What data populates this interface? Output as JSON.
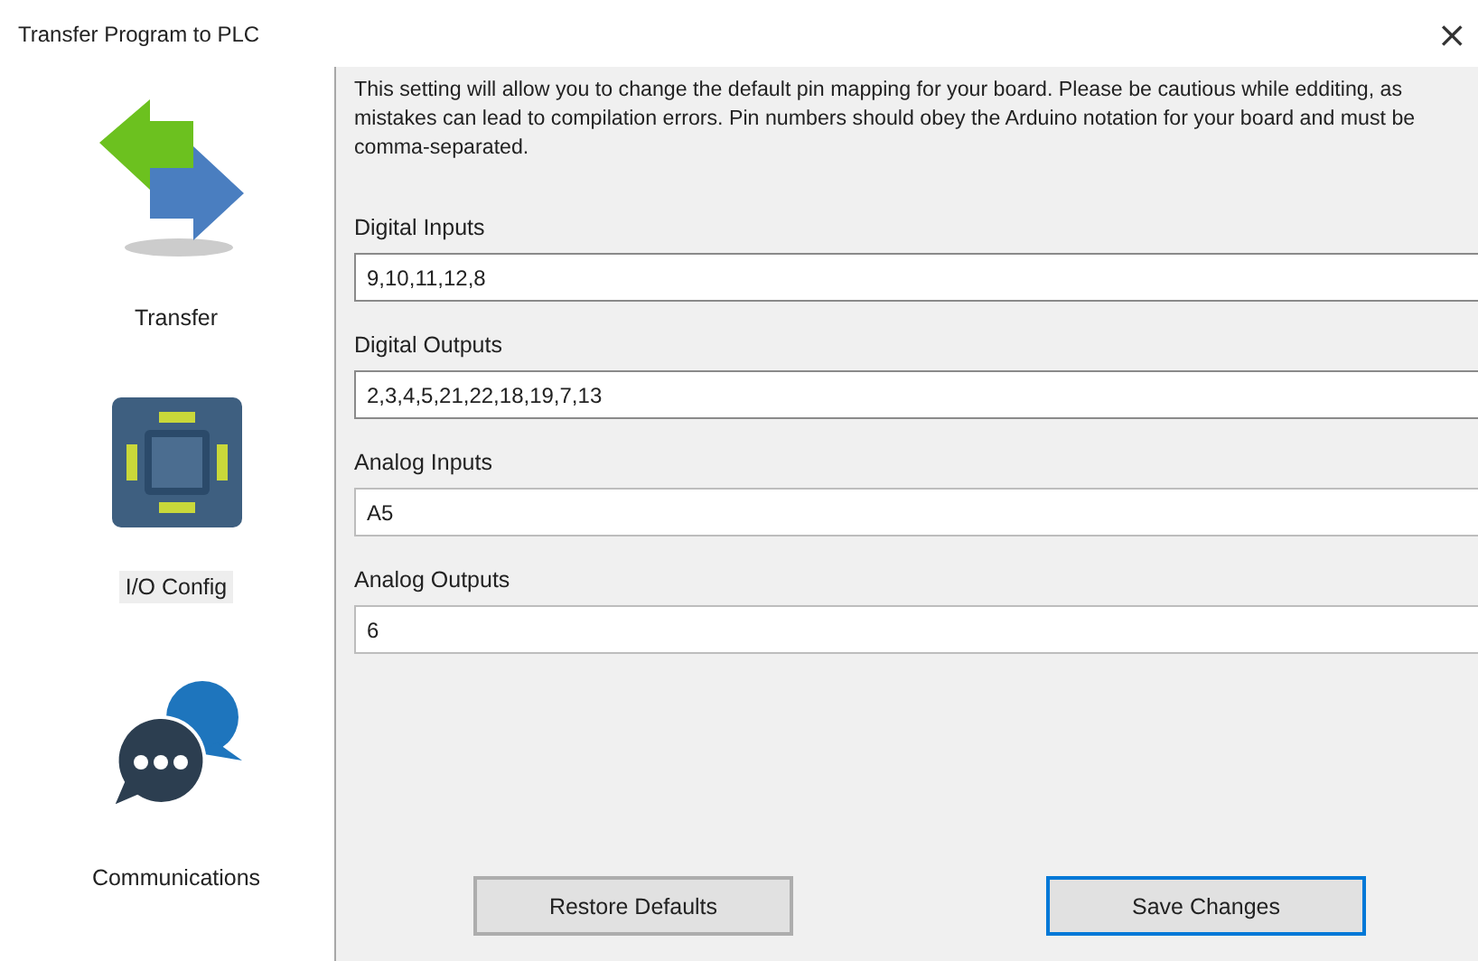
{
  "window": {
    "title": "Transfer Program to PLC",
    "close": "×"
  },
  "sidebar": {
    "items": [
      {
        "label": "Transfer",
        "kind": "transfer",
        "selected": false
      },
      {
        "label": "I/O Config",
        "kind": "board",
        "selected": true
      },
      {
        "label": "Communications",
        "kind": "chat",
        "selected": false
      }
    ]
  },
  "description": "This setting will allow you to change the default pin mapping for your board. Please be cautious while edditing, as mistakes can lead to compilation errors. Pin numbers should obey the Arduino notation for your board and must be comma-separated.",
  "fields": [
    {
      "label": "Digital Inputs",
      "value": "9,10,11,12,8"
    },
    {
      "label": "Digital Outputs",
      "value": "2,3,4,5,21,22,18,19,7,13"
    },
    {
      "label": "Analog Inputs",
      "value": "A5"
    },
    {
      "label": "Analog Outputs",
      "value": "6"
    }
  ],
  "buttons": [
    {
      "label": "Restore Defaults",
      "focused": false
    },
    {
      "label": "Save Changes",
      "focused": true
    }
  ]
}
